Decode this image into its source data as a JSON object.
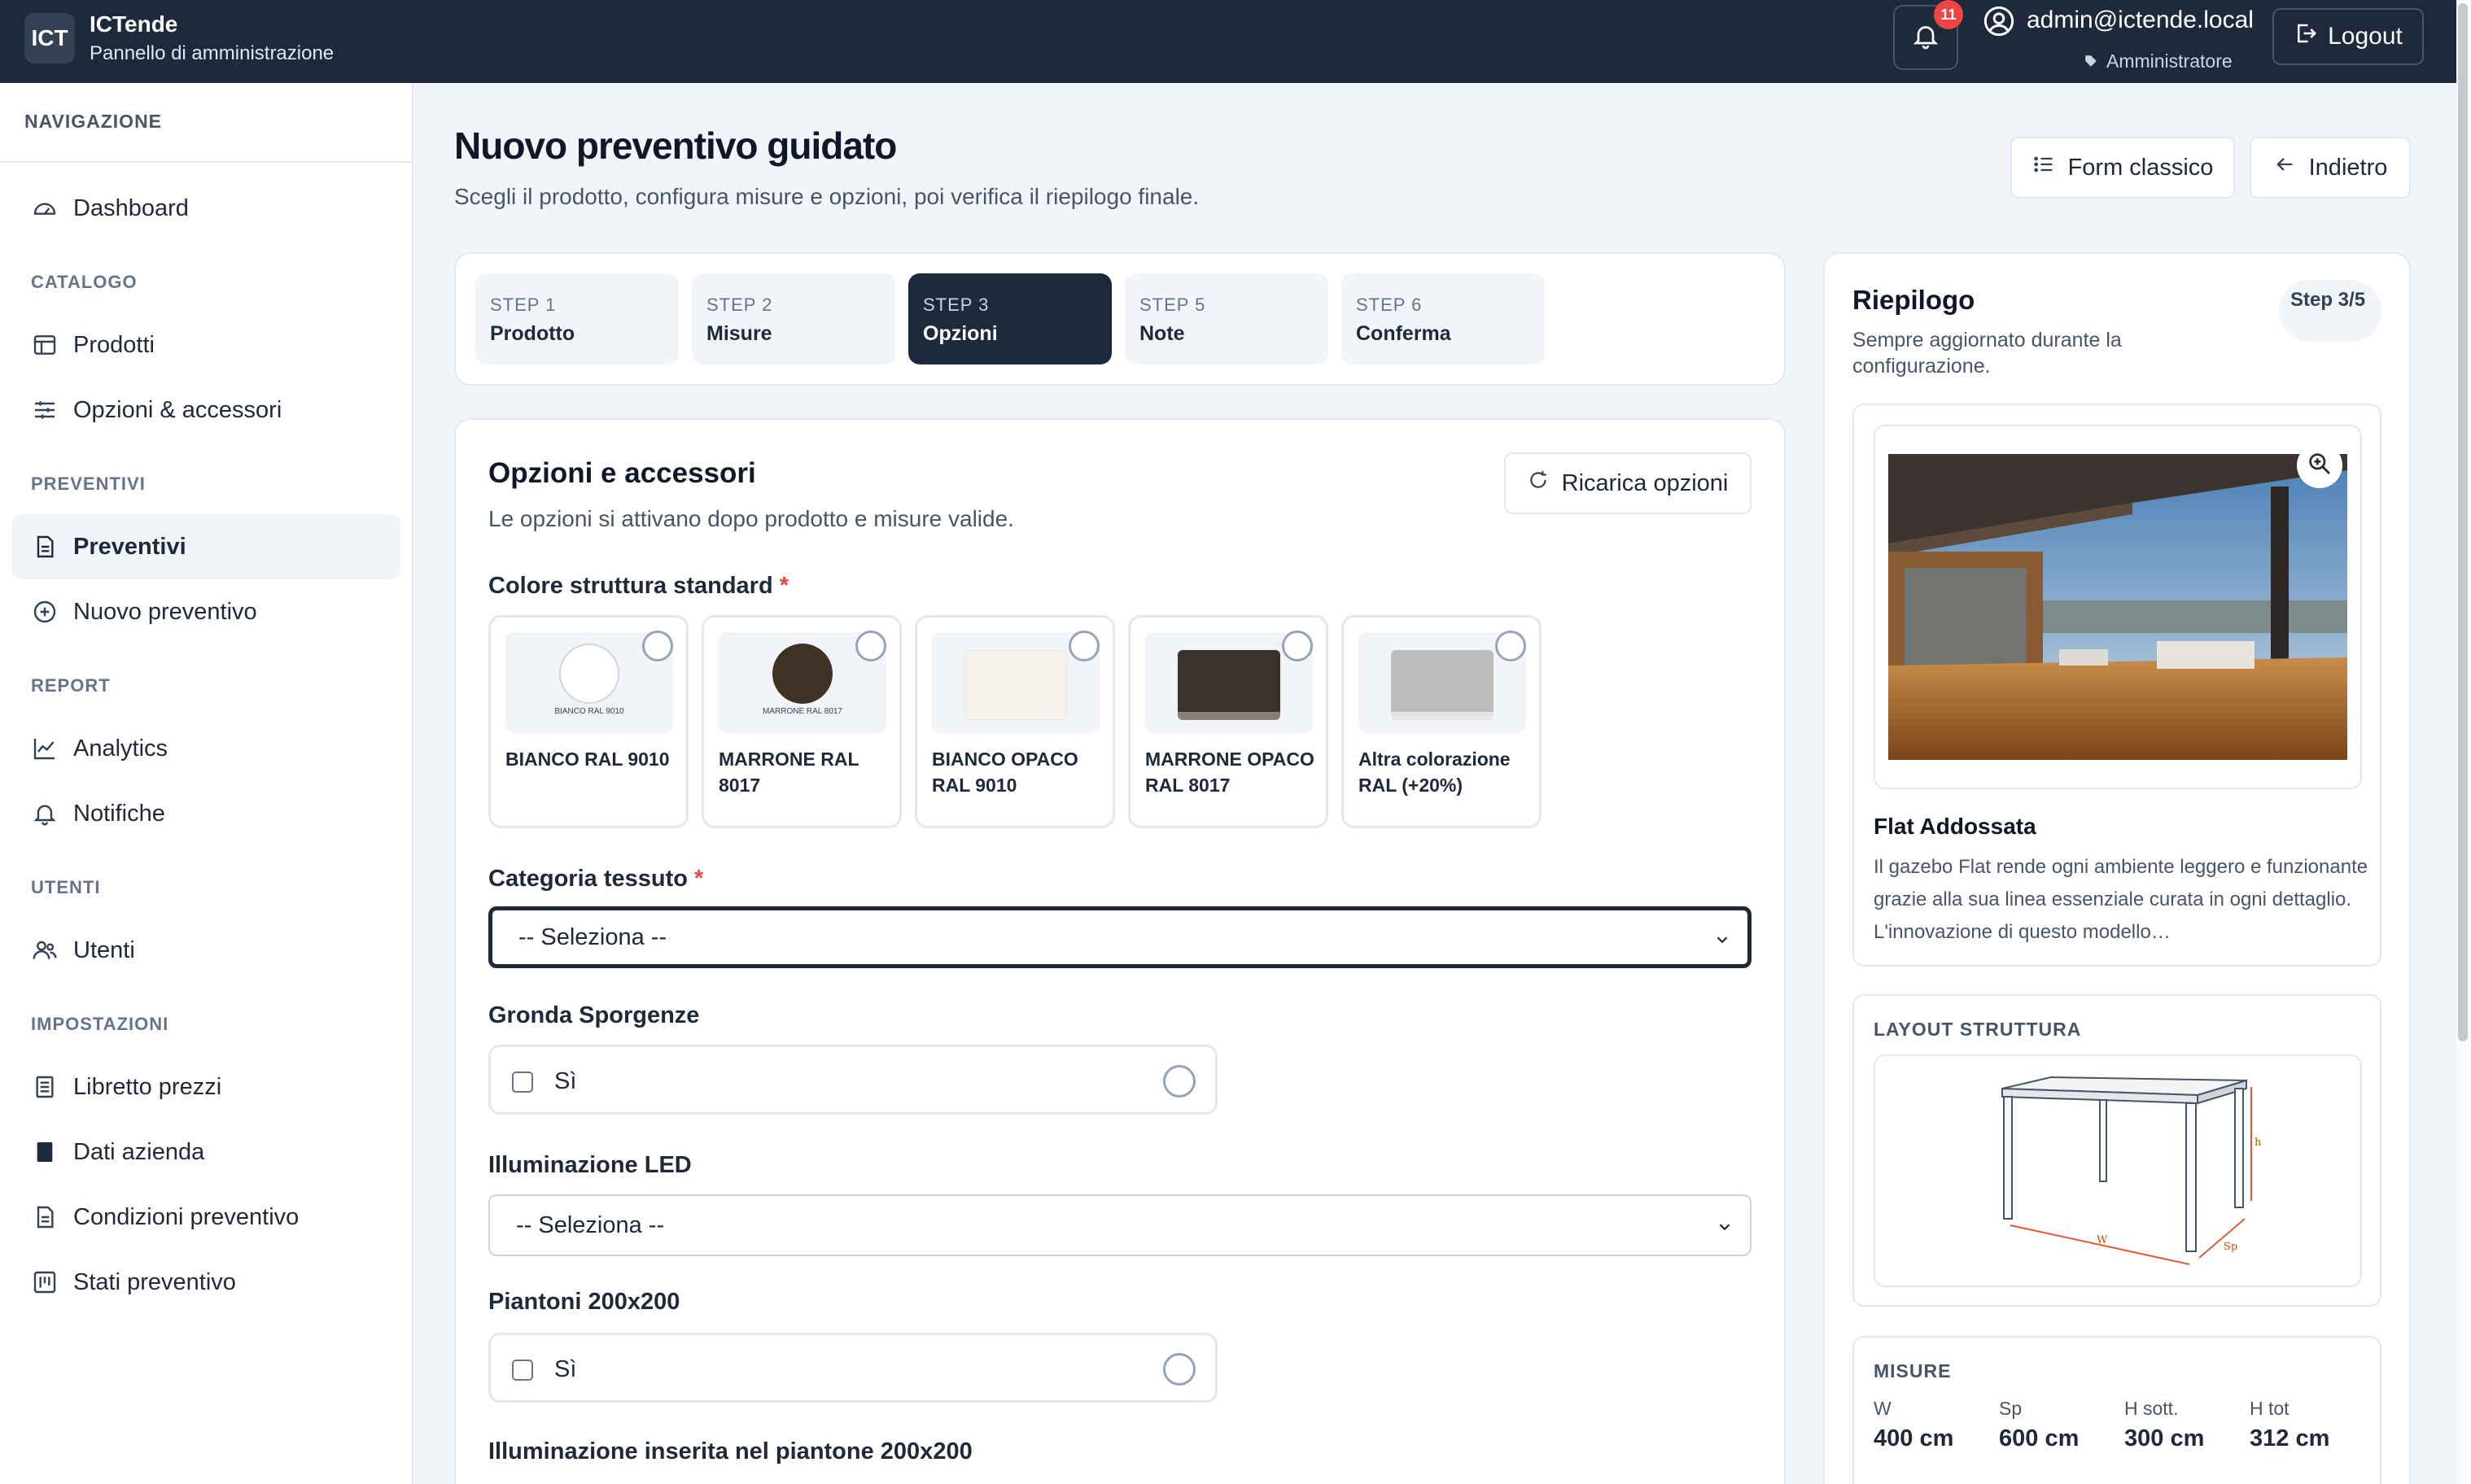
{
  "header": {
    "logo": "ICT",
    "app_name": "ICTende",
    "app_sub": "Pannello di amministrazione",
    "notif_count": "11",
    "user_email": "admin@ictende.local",
    "user_role": "Amministratore",
    "logout": "Logout"
  },
  "sidebar": {
    "nav_header": "NAVIGAZIONE",
    "sections": [
      "CATALOGO",
      "PREVENTIVI",
      "REPORT",
      "UTENTI",
      "IMPOSTAZIONI"
    ],
    "items": [
      {
        "label": "Dashboard",
        "icon": "gauge-icon"
      },
      {
        "label": "Prodotti",
        "icon": "table-icon"
      },
      {
        "label": "Opzioni & accessori",
        "icon": "sliders-icon"
      },
      {
        "label": "Preventivi",
        "icon": "document-icon",
        "active": true
      },
      {
        "label": "Nuovo preventivo",
        "icon": "plus-circle-icon"
      },
      {
        "label": "Analytics",
        "icon": "chart-line-icon"
      },
      {
        "label": "Notifiche",
        "icon": "bell-icon"
      },
      {
        "label": "Utenti",
        "icon": "users-icon"
      },
      {
        "label": "Libretto prezzi",
        "icon": "list-doc-icon"
      },
      {
        "label": "Dati azienda",
        "icon": "building-icon"
      },
      {
        "label": "Condizioni preventivo",
        "icon": "document-icon"
      },
      {
        "label": "Stati preventivo",
        "icon": "kanban-icon"
      }
    ]
  },
  "main": {
    "title": "Nuovo preventivo guidato",
    "subtitle": "Scegli il prodotto, configura misure e opzioni, poi verifica il riepilogo finale.",
    "btn_form": "Form classico",
    "btn_back": "Indietro",
    "steps": [
      {
        "num": "STEP 1",
        "label": "Prodotto"
      },
      {
        "num": "STEP 2",
        "label": "Misure"
      },
      {
        "num": "STEP 3",
        "label": "Opzioni",
        "active": true
      },
      {
        "num": "STEP 5",
        "label": "Note"
      },
      {
        "num": "STEP 6",
        "label": "Conferma"
      }
    ],
    "options": {
      "title": "Opzioni e accessori",
      "subtitle": "Le opzioni si attivano dopo prodotto e misure valide.",
      "reload": "Ricarica opzioni",
      "color_label": "Colore struttura standard",
      "colors": [
        {
          "label": "BIANCO RAL 9010",
          "swatch_text": "BIANCO RAL 9010",
          "color": "#ffffff"
        },
        {
          "label": "MARRONE RAL 8017",
          "swatch_text": "MARRONE RAL 8017",
          "color": "#3f3124"
        },
        {
          "label": "BIANCO OPACO RAL 9010",
          "color": "#f5f3ec"
        },
        {
          "label": "MARRONE OPACO RAL 8017",
          "color": "#3b322b"
        },
        {
          "label": "Altra colorazione RAL (+20%)",
          "color": "#bdbdbd"
        }
      ],
      "fabric_label": "Categoria tessuto",
      "fabric_value": "-- Seleziona --",
      "gronda_label": "Gronda Sporgenze",
      "gronda_check": "Sì",
      "led_label": "Illuminazione LED",
      "led_value": "-- Seleziona --",
      "piantoni_label": "Piantoni 200x200",
      "piantoni_check": "Sì",
      "ill_piantone_label": "Illuminazione inserita nel piantone 200x200"
    }
  },
  "summary": {
    "title": "Riepilogo",
    "subtitle": "Sempre aggiornato durante la configurazione.",
    "step_badge": "Step 3/5",
    "product_name": "Flat Addossata",
    "product_desc": "Il gazebo Flat rende ogni ambiente leggero e funzionante grazie alla sua linea essenziale curata in ogni dettaglio. L'innovazione di questo modello…",
    "layout_title": "LAYOUT STRUTTURA",
    "diagram_labels": {
      "w": "W",
      "sp": "Sp",
      "h": "h"
    },
    "measures_title": "MISURE",
    "measures": [
      {
        "label": "W",
        "value": "400 cm"
      },
      {
        "label": "Sp",
        "value": "600 cm"
      },
      {
        "label": "H sott.",
        "value": "300 cm"
      },
      {
        "label": "H tot",
        "value": "312 cm"
      }
    ]
  }
}
